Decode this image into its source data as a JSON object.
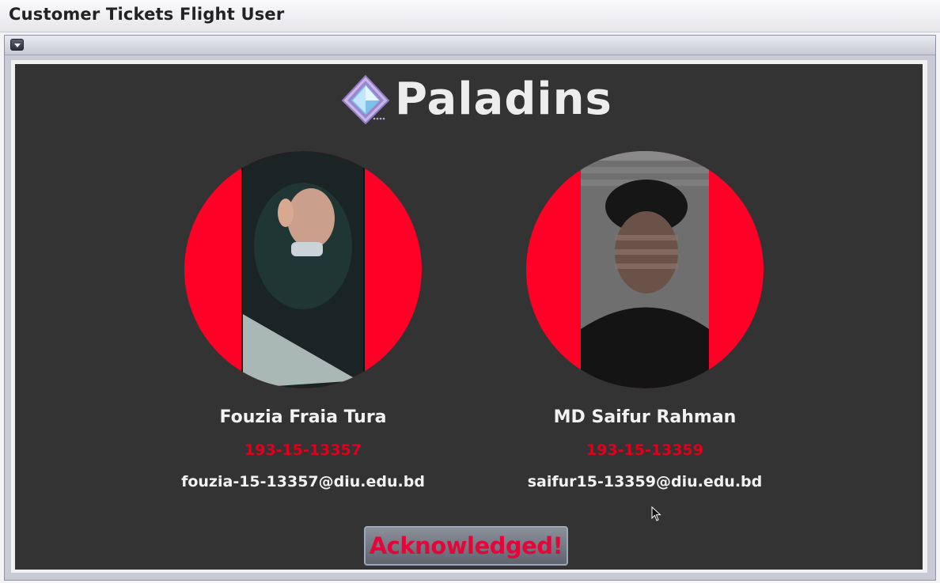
{
  "window": {
    "title": "Customer Tickets Flight User"
  },
  "brand": {
    "name": "Paladins",
    "logo_icon": "crystal-gem-icon"
  },
  "members": [
    {
      "name": "Fouzia Fraia Tura",
      "id": "193-15-13357",
      "email": "fouzia-15-13357@diu.edu.bd"
    },
    {
      "name": "MD Saifur Rahman",
      "id": "193-15-13359",
      "email": "saifur15-13359@diu.edu.bd"
    }
  ],
  "actions": {
    "acknowledge_label": "Acknowledged!"
  },
  "colors": {
    "accent_red": "#ff0026",
    "panel_bg": "#333333",
    "id_text": "#e0001c"
  }
}
